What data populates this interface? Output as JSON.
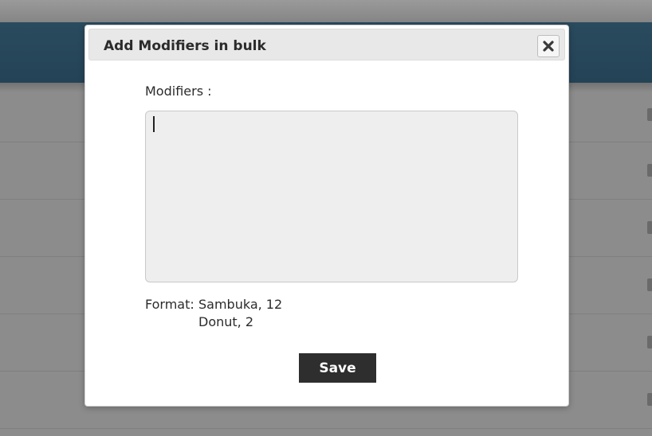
{
  "dialog": {
    "title": "Add Modifiers in bulk",
    "close_icon": "close-x-icon"
  },
  "form": {
    "modifiers_label": "Modifiers :",
    "modifiers_value": "",
    "format_label": "Format:",
    "format_example_line1": "Sambuka, 12",
    "format_example_line2": "Donut, 2",
    "save_label": "Save"
  },
  "colors": {
    "header_bar": "#244356",
    "overlay": "#8c8c8c",
    "save_button": "#2e2e2e",
    "textarea_bg": "#eeeeee"
  }
}
